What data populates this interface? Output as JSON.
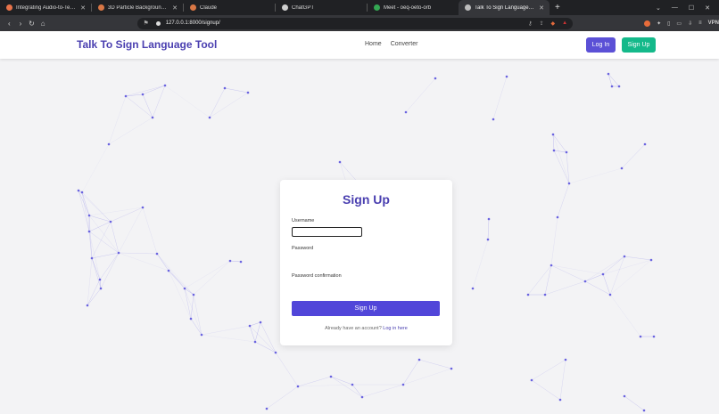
{
  "browser": {
    "tabs": [
      {
        "title": "Integrating Audio-to-Text Conv",
        "color": "#e8734a",
        "active": false
      },
      {
        "title": "3D Particle Background Effect - Cla",
        "color": "#d97745",
        "active": false
      },
      {
        "title": "Claude",
        "color": "#d97745",
        "active": false
      },
      {
        "title": "ChatGPT",
        "color": "#cfcfcf",
        "active": false
      },
      {
        "title": "Meet - oeq-oeto-orb",
        "color": "#34a853",
        "active": false
      },
      {
        "title": "Talk To Sign Language Tool",
        "color": "#bdbdbd",
        "active": true
      }
    ],
    "new_tab": "+",
    "url": "127.0.0.1:8000/signup/",
    "vpn_label": "VPN"
  },
  "header": {
    "brand": "Talk To Sign Language Tool",
    "nav": [
      "Home",
      "Converter"
    ],
    "login": "Log In",
    "signup": "Sign Up"
  },
  "form": {
    "title": "Sign Up",
    "username_label": "Username",
    "password_label": "Password",
    "password_confirm_label": "Password confirmation",
    "submit": "Sign Up",
    "footer_text": "Already have an account?",
    "footer_link": "Log in here"
  },
  "colors": {
    "brand": "#4a3fb0",
    "primary": "#5b50d6",
    "success": "#14b98a",
    "particle": "#6a63e0"
  }
}
